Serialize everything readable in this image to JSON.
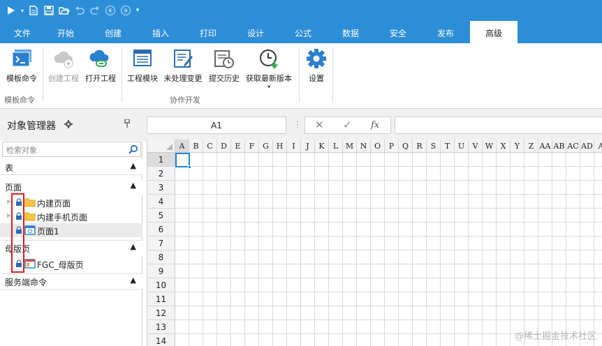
{
  "quick_access": {
    "icons": [
      "play-icon",
      "dropdown-small-icon",
      "new-file-icon",
      "save-icon",
      "open-folder-icon",
      "undo-icon",
      "redo-icon",
      "back-circle-icon",
      "forward-circle-icon",
      "customize-dropdown-icon"
    ]
  },
  "menu": {
    "tabs": [
      {
        "label": "文件"
      },
      {
        "label": "开始"
      },
      {
        "label": "创建"
      },
      {
        "label": "插入"
      },
      {
        "label": "打印"
      },
      {
        "label": "设计"
      },
      {
        "label": "公式"
      },
      {
        "label": "数据"
      },
      {
        "label": "安全"
      },
      {
        "label": "发布"
      },
      {
        "label": "高级"
      }
    ],
    "active_tab": "高级"
  },
  "ribbon": {
    "buttons": {
      "template_cmd": "模板命令",
      "create_project": "创建工程",
      "open_project": "打开工程",
      "project_module": "工程模块",
      "pending_changes": "未处理变更",
      "commit_history": "提交历史",
      "get_latest": "获取最新版本",
      "settings": "设置"
    },
    "groups": {
      "template": "模板命令",
      "collab": "协作开发"
    }
  },
  "object_manager": {
    "title": "对象管理器",
    "search_placeholder": "检索对象",
    "sections": {
      "tables": "表",
      "pages": "页面",
      "master": "母版页",
      "server_cmd": "服务端命令"
    },
    "pages_items": [
      {
        "label": "内建页面"
      },
      {
        "label": "内建手机页面"
      },
      {
        "label": "页面1"
      }
    ],
    "master_items": [
      {
        "label": "FGC_母版页"
      }
    ]
  },
  "formula": {
    "cell_ref": "A1",
    "fx": "fx"
  },
  "sheet": {
    "columns": [
      "A",
      "B",
      "C",
      "D",
      "E",
      "F",
      "G",
      "H",
      "I",
      "J",
      "K",
      "L",
      "M",
      "N",
      "O",
      "P",
      "Q",
      "R",
      "S",
      "T",
      "U",
      "V",
      "W",
      "X",
      "Y",
      "Z",
      "AA",
      "AB",
      "AC",
      "AD",
      "A"
    ],
    "rows": [
      "1",
      "2",
      "3",
      "4",
      "5",
      "6",
      "7",
      "8",
      "9",
      "10",
      "11",
      "12",
      "13",
      "14"
    ],
    "selected_cell": "A1"
  },
  "colors": {
    "brand": "#2d8ed8",
    "selection": "#1e86d8",
    "highlight_box": "#e02020"
  },
  "watermark": "@稀土掘金技术社区"
}
